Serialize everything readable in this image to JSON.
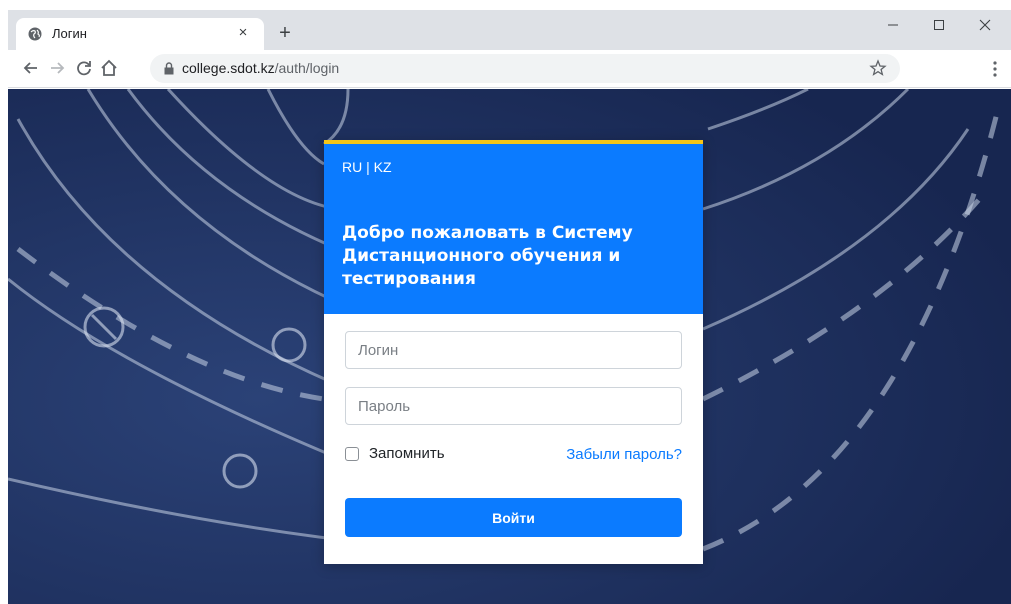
{
  "browser": {
    "tab": {
      "title": "Логин",
      "close_glyph": "×"
    },
    "new_tab_glyph": "+",
    "address": {
      "host": "college.sdot.kz",
      "path": "/auth/login"
    }
  },
  "card": {
    "lang_ru": "RU",
    "lang_sep": "|",
    "lang_kz": "KZ",
    "welcome": "Добро пожаловать в Систему Дистанционного обучения и тестирования",
    "login_placeholder": "Логин",
    "password_placeholder": "Пароль",
    "remember_label": "Запомнить",
    "remember_checked": false,
    "forgot_label": "Забыли пароль?",
    "submit_label": "Войти"
  },
  "colors": {
    "header_blue": "#0b7bff",
    "header_top_strip": "#f5c518",
    "background_navy": "#1c2d55",
    "link_blue": "#0b7bff"
  },
  "icons": [
    "globe-icon",
    "close-icon",
    "plus-icon",
    "minimize-icon",
    "maximize-icon",
    "window-close-icon",
    "back-arrow-icon",
    "forward-arrow-icon",
    "reload-icon",
    "home-icon",
    "lock-icon",
    "star-icon",
    "menu-dots-icon"
  ]
}
